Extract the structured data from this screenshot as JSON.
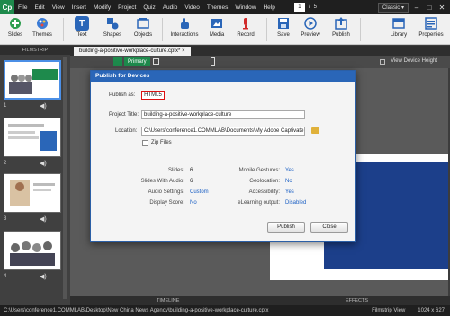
{
  "app": {
    "logo": "Cp",
    "menu": [
      "File",
      "Edit",
      "View",
      "Insert",
      "Modify",
      "Project",
      "Quiz",
      "Audio",
      "Video",
      "Themes",
      "Window",
      "Help"
    ],
    "page_current": "1",
    "page_sep": "/",
    "page_total": "5",
    "workspace": "Classic",
    "workspace_arrow": "▾",
    "win_min": "–",
    "win_max": "□",
    "win_close": "✕"
  },
  "toolbar": {
    "slides": "Slides",
    "themes": "Themes",
    "text": "Text",
    "shapes": "Shapes",
    "objects": "Objects",
    "interactions": "Interactions",
    "media": "Media",
    "record": "Record",
    "save": "Save",
    "preview": "Preview",
    "publish": "Publish",
    "library": "Library",
    "properties": "Properties"
  },
  "filmstrip": {
    "header": "FILMSTRIP",
    "slides": [
      {
        "num": "1",
        "audio": "◀)"
      },
      {
        "num": "2",
        "audio": "◀)"
      },
      {
        "num": "3",
        "audio": "◀)"
      },
      {
        "num": "4",
        "audio": "◀)"
      }
    ]
  },
  "document": {
    "tab": "building-a-positive-workplace-culture.cptx*",
    "tab_close": "×",
    "primary": "Primary",
    "view_device_height": "View Device Height",
    "stage_text": "ulture"
  },
  "bottom": {
    "timeline": "TIMELINE",
    "effects": "EFFECTS"
  },
  "status": {
    "path": "C:\\Users\\conference1.COMMLAB\\Desktop\\New China News Agency\\building-a-positive-workplace-culture.cptx",
    "view": "Filmstrip View",
    "size": "1024 x 627"
  },
  "dialog": {
    "title": "Publish for Devices",
    "publish_as_label": "Publish as:",
    "publish_as_value": "HTML5",
    "project_title_label": "Project Title:",
    "project_title_value": "building-a-positive-workplace-culture",
    "location_label": "Location:",
    "location_value": "C:\\Users\\conference1.COMMLAB\\Documents\\My Adobe Captivate Projects",
    "zip_label": "Zip Files",
    "slides_label": "Slides:",
    "slides_value": "6",
    "slides_audio_label": "Slides With Audio:",
    "slides_audio_value": "6",
    "audio_settings_label": "Audio Settings:",
    "audio_settings_value": "Custom",
    "display_score_label": "Display Score:",
    "display_score_value": "No",
    "mobile_gestures_label": "Mobile Gestures:",
    "mobile_gestures_value": "Yes",
    "geolocation_label": "Geolocation:",
    "geolocation_value": "No",
    "accessibility_label": "Accessibility:",
    "accessibility_value": "Yes",
    "elearning_label": "eLearning output:",
    "elearning_value": "Disabled",
    "publish_button": "Publish",
    "close_button": "Close"
  },
  "colors": {
    "accent": "#2a66b8",
    "brand": "#1e8a4c",
    "highlight": "#dd1111",
    "link": "#1a5fc4"
  }
}
